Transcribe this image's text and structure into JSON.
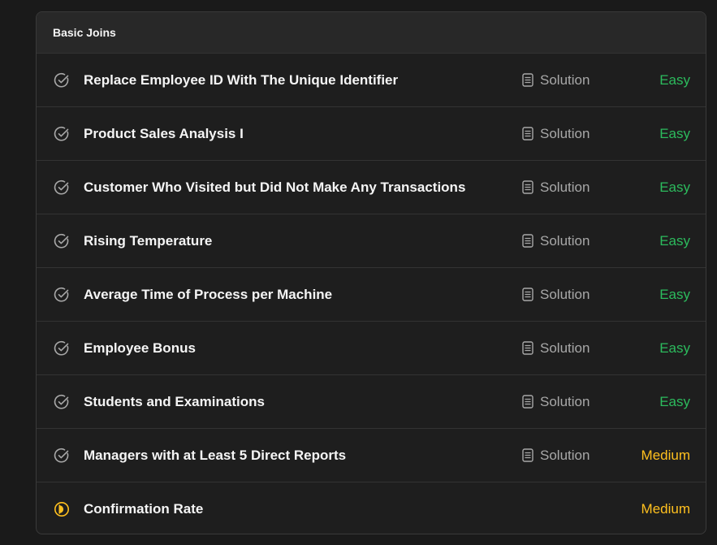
{
  "section": {
    "title": "Basic Joins"
  },
  "solution_label": "Solution",
  "colors": {
    "easy": "#2cbb5d",
    "medium": "#ffc01e",
    "solved_icon": "#a8a8a8",
    "attempted_icon": "#ffc01e"
  },
  "problems": [
    {
      "title": "Replace Employee ID With The Unique Identifier",
      "status_icon": "check-circle-icon",
      "solution": "Solution",
      "difficulty": "Easy",
      "level": "easy"
    },
    {
      "title": "Product Sales Analysis I",
      "status_icon": "check-circle-icon",
      "solution": "Solution",
      "difficulty": "Easy",
      "level": "easy"
    },
    {
      "title": "Customer Who Visited but Did Not Make Any Transactions",
      "status_icon": "check-circle-icon",
      "solution": "Solution",
      "difficulty": "Easy",
      "level": "easy"
    },
    {
      "title": "Rising Temperature",
      "status_icon": "check-circle-icon",
      "solution": "Solution",
      "difficulty": "Easy",
      "level": "easy"
    },
    {
      "title": "Average Time of Process per Machine",
      "status_icon": "check-circle-icon",
      "solution": "Solution",
      "difficulty": "Easy",
      "level": "easy"
    },
    {
      "title": "Employee Bonus",
      "status_icon": "check-circle-icon",
      "solution": "Solution",
      "difficulty": "Easy",
      "level": "easy"
    },
    {
      "title": "Students and Examinations",
      "status_icon": "check-circle-icon",
      "solution": "Solution",
      "difficulty": "Easy",
      "level": "easy"
    },
    {
      "title": "Managers with at Least 5 Direct Reports",
      "status_icon": "check-circle-icon",
      "solution": "Solution",
      "difficulty": "Medium",
      "level": "medium"
    },
    {
      "title": "Confirmation Rate",
      "status_icon": "attempted-icon",
      "solution": "",
      "difficulty": "Medium",
      "level": "medium"
    }
  ]
}
